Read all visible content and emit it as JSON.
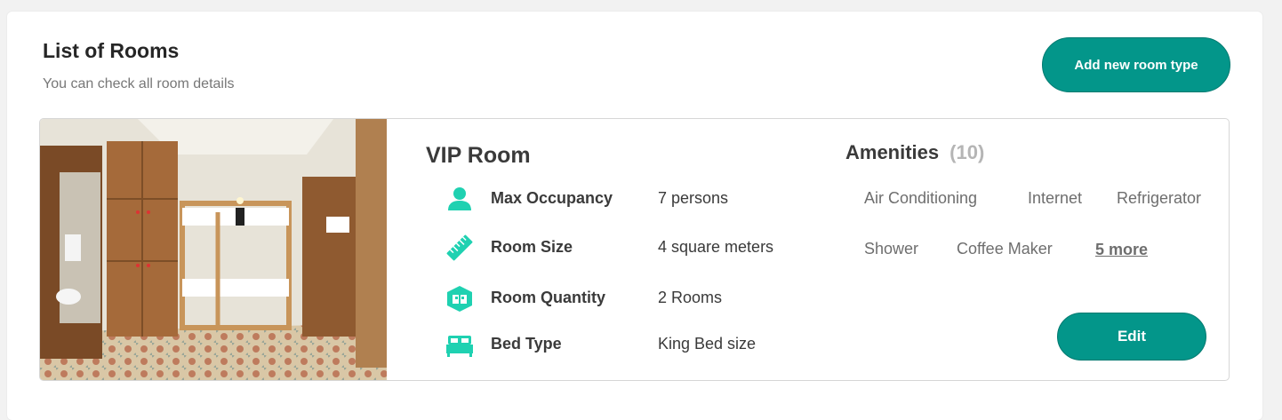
{
  "header": {
    "title": "List of Rooms",
    "subtitle": "You can check all room details",
    "add_button": "Add new room type"
  },
  "room": {
    "name": "VIP Room",
    "specs": [
      {
        "icon": "person-icon",
        "label": "Max Occupancy",
        "value": "7 persons"
      },
      {
        "icon": "ruler-icon",
        "label": "Room Size",
        "value": "4 square meters"
      },
      {
        "icon": "room-quantity-icon",
        "label": "Room Quantity",
        "value": "2 Rooms"
      },
      {
        "icon": "bed-icon",
        "label": "Bed Type",
        "value": "King Bed size"
      }
    ],
    "amenities_title": "Amenities",
    "amenities_count": "(10)",
    "amenities": [
      "Air Conditioning",
      "Internet",
      "Refrigerator",
      "Shower",
      "Coffee Maker"
    ],
    "more_link": "5 more",
    "edit_button": "Edit"
  },
  "colors": {
    "accent": "#03968a",
    "icon": "#1fd1b1"
  }
}
